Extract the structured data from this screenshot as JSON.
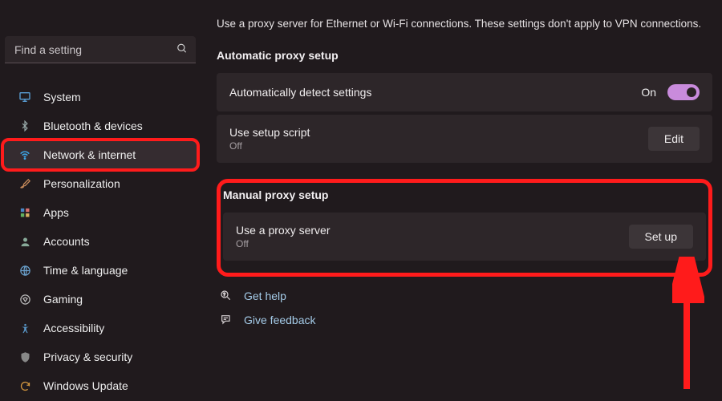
{
  "search": {
    "placeholder": "Find a setting"
  },
  "sidebar": {
    "items": [
      {
        "label": "System"
      },
      {
        "label": "Bluetooth & devices"
      },
      {
        "label": "Network & internet"
      },
      {
        "label": "Personalization"
      },
      {
        "label": "Apps"
      },
      {
        "label": "Accounts"
      },
      {
        "label": "Time & language"
      },
      {
        "label": "Gaming"
      },
      {
        "label": "Accessibility"
      },
      {
        "label": "Privacy & security"
      },
      {
        "label": "Windows Update"
      }
    ]
  },
  "main": {
    "intro": "Use a proxy server for Ethernet or Wi-Fi connections. These settings don't apply to VPN connections.",
    "auto": {
      "title": "Automatic proxy setup",
      "detect": {
        "title": "Automatically detect settings",
        "state": "On"
      },
      "script": {
        "title": "Use setup script",
        "sub": "Off",
        "button": "Edit"
      }
    },
    "manual": {
      "title": "Manual proxy setup",
      "proxy": {
        "title": "Use a proxy server",
        "sub": "Off",
        "button": "Set up"
      }
    },
    "help": {
      "label": "Get help"
    },
    "feedback": {
      "label": "Give feedback"
    }
  }
}
